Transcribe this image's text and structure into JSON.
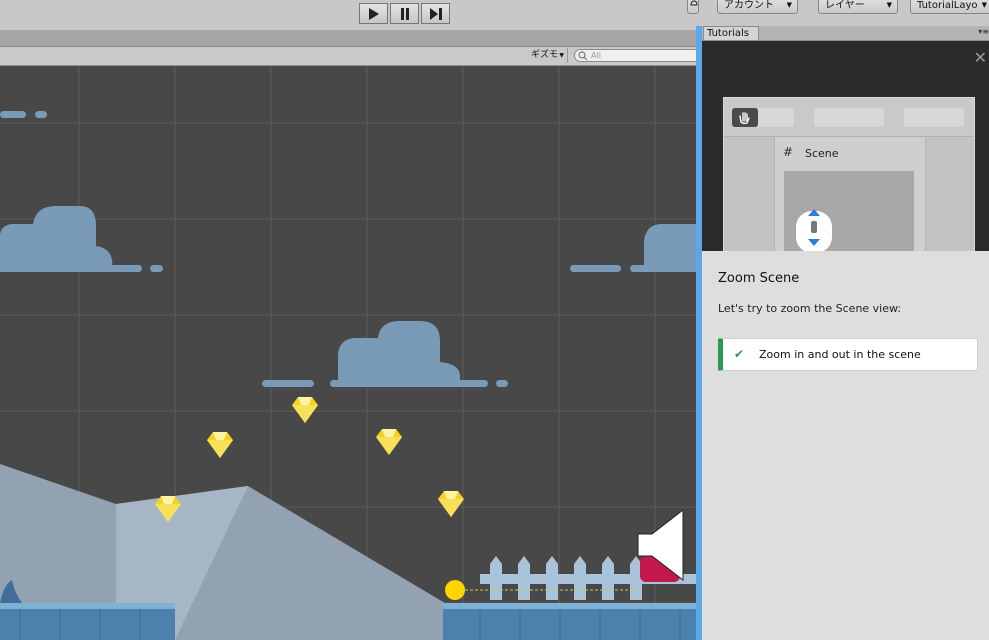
{
  "toolbar": {
    "account_label": "アカウント",
    "layers_label": "レイヤー",
    "layout_label": "TutorialLayo",
    "play_icon": "play-icon",
    "pause_icon": "pause-icon",
    "step_icon": "step-icon"
  },
  "scene_toolbar": {
    "gizmos_label": "ギズモ",
    "search_placeholder": "All"
  },
  "tutorial": {
    "tab_label": "Tutorials",
    "hero_scene_label": "Scene",
    "step_title": "Zoom Scene",
    "step_description": "Let's try to zoom the Scene view:",
    "task_label": "Zoom in and out in the scene",
    "task_completed": true
  },
  "colors": {
    "accent": "#5aa8e6",
    "scene_background": "#484848",
    "task_done": "#2c9a55",
    "gem": "#f6d21f",
    "cloud": "#7b9cb8"
  }
}
